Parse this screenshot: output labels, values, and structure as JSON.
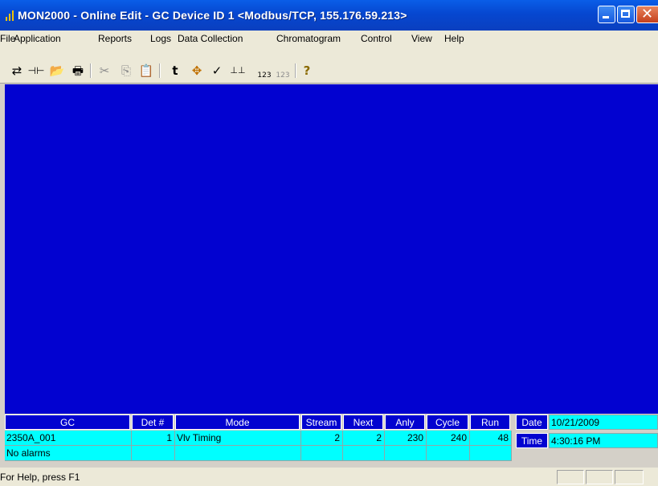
{
  "window": {
    "title": "MON2000 - Online Edit - GC Device ID 1 <Modbus/TCP, 155.176.59.213>",
    "close_glyph": "✕"
  },
  "menu": [
    "File",
    "Application",
    "Reports",
    "Logs",
    "Data Collection",
    "Chromatogram",
    "Control",
    "View",
    "Help"
  ],
  "toolbar": {
    "icons": [
      "connect-icon",
      "disconnect-icon",
      "open-folder-icon",
      "print-icon",
      "cut-icon",
      "copy-icon",
      "paste-icon",
      "peak-icon",
      "crosshair-icon",
      "checkmark-icon",
      "baseline-icon",
      "increment-number-icon",
      "delete-number-icon",
      "help-icon"
    ],
    "glyphs": {
      "connect": "⇄",
      "disconnect": "⊣⊢",
      "open": "📂",
      "print": "🖶",
      "cut": "✂",
      "copy": "⎘",
      "paste": "📋",
      "peak": "t",
      "crosshair": "✥",
      "check": "✓",
      "baseline": "⊥⊥",
      "num1": "123",
      "num2": "123",
      "help": "?"
    }
  },
  "status_grid": {
    "headers": {
      "gc": "GC",
      "det": "Det #",
      "mode": "Mode",
      "stream": "Stream",
      "next": "Next",
      "anly": "Anly",
      "cycle": "Cycle",
      "run": "Run",
      "date": "Date",
      "time": "Time"
    },
    "row": {
      "gc": "2350A_001",
      "det": "1",
      "mode": "Vlv Timing",
      "stream": "2",
      "next": "2",
      "anly": "230",
      "cycle": "240",
      "run": "48"
    },
    "alarm_text": "No alarms",
    "date_value": "10/21/2009",
    "time_value": "4:30:16 PM"
  },
  "statusbar": {
    "help_text": "For Help, press F1"
  },
  "colors": {
    "titlebar": "#0a5ee8",
    "client_area": "#0202d0",
    "grid_header": "#0202d0",
    "grid_cell": "#00ffff",
    "chrome": "#ece9d8"
  }
}
